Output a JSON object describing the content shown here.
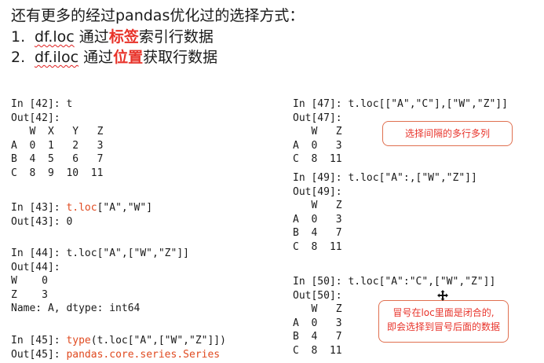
{
  "heading": "还有更多的经过pandas优化过的选择方式：",
  "items": [
    {
      "num": "1.",
      "code": "df.loc",
      "pre": " 通过",
      "highlight": "标签",
      "post": "索引行数据"
    },
    {
      "num": "2.",
      "code": "df.iloc",
      "pre": " 通过",
      "highlight": "位置",
      "post": "获取行数据"
    }
  ],
  "left": {
    "b1_in": "In [42]: t",
    "b1_out": "Out[42]:\n   W  X   Y   Z\nA  0  1   2   3\nB  4  5   6   7\nC  8  9  10  11",
    "b2_prompt": "In [43]: ",
    "b2_call": "t.loc",
    "b2_args": "[\"A\",\"W\"]",
    "b2_out": "Out[43]: 0",
    "b3_in": "In [44]: t.loc[\"A\",[\"W\",\"Z\"]]",
    "b3_out": "Out[44]:\nW    0\nZ    3\nName: A, dtype: int64",
    "b4_prompt": "In [45]: ",
    "b4_call": "type",
    "b4_args": "(t.loc[\"A\",[\"W\",\"Z\"]])",
    "b4_out_prompt": "Out[45]: ",
    "b4_out_val": "pandas.core.series.Series"
  },
  "right": {
    "b1_in": "In [47]: t.loc[[\"A\",\"C\"],[\"W\",\"Z\"]]",
    "b1_out": "Out[47]:\n   W   Z\nA  0   3\nC  8  11",
    "b2_in": "In [49]: t.loc[\"A\":,[\"W\",\"Z\"]]",
    "b2_out": "Out[49]:\n   W   Z\nA  0   3\nB  4   7\nC  8  11",
    "b3_in": "In [50]: t.loc[\"A\":\"C\",[\"W\",\"Z\"]]",
    "b3_out": "Out[50]:\n   W   Z\nA  0   3\nB  4   7\nC  8  11"
  },
  "notes": {
    "note1": "选择间隔的多行多列",
    "note2_line1": "冒号在loc里面是闭合的,",
    "note2_line2": "即会选择到冒号后面的数据"
  }
}
